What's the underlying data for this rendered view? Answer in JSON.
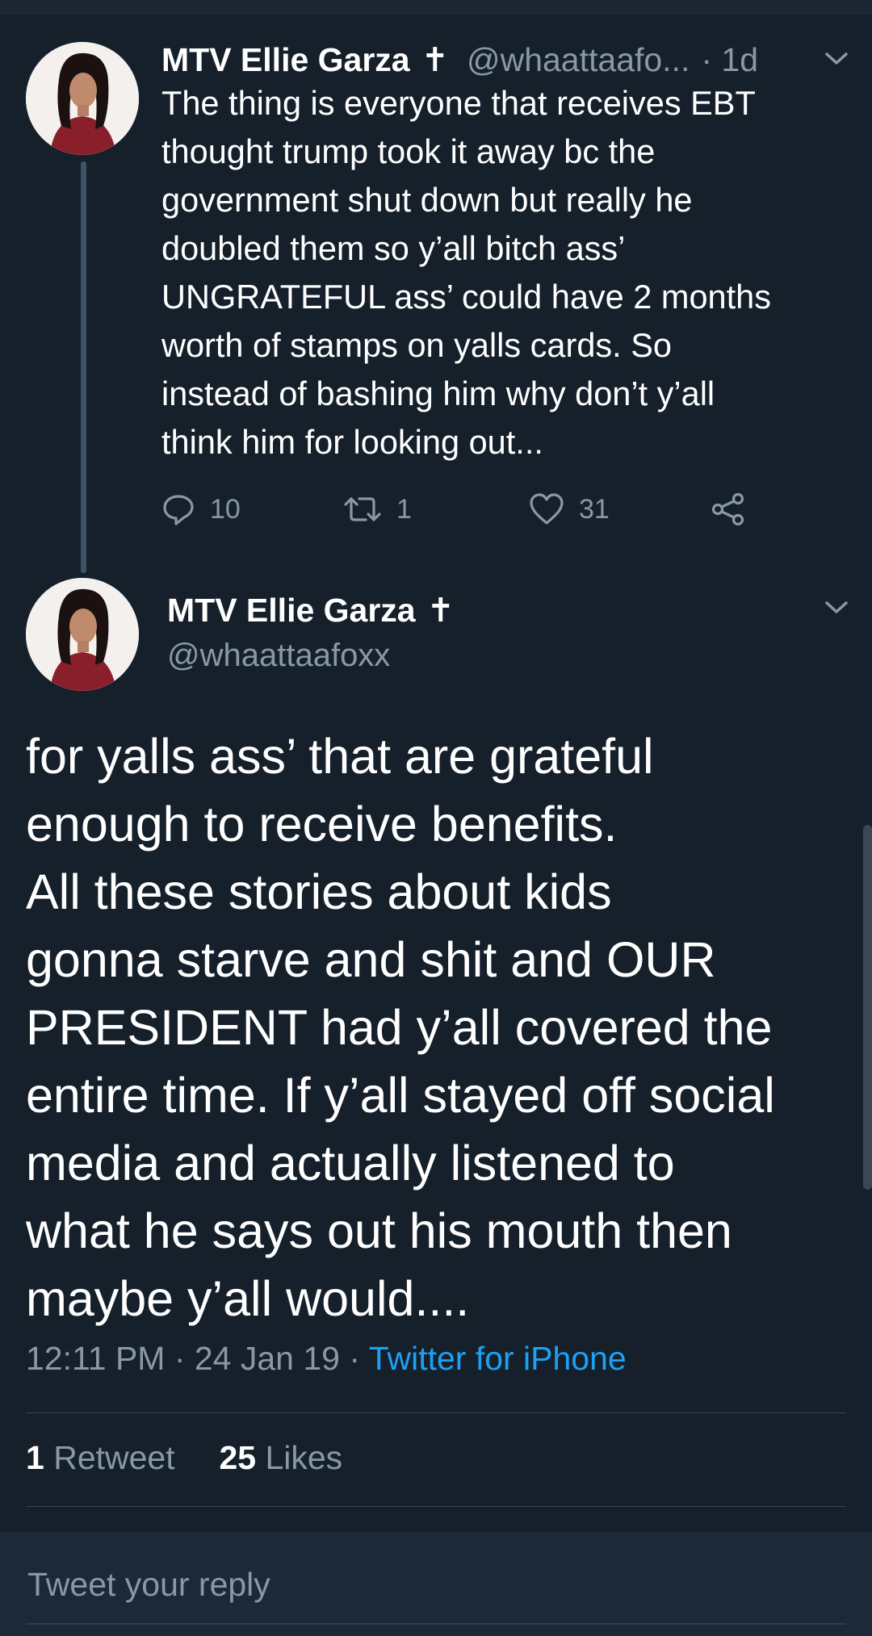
{
  "parent_tweet": {
    "display_name": "MTV Ellie Garza",
    "badge": "✝",
    "handle_truncated": "@whaattaafo...",
    "time_ago": "· 1d",
    "text": "The thing is everyone that receives EBT\nthought trump took it away bc the\ngovernment shut down but really he\ndoubled them so y’all bitch ass’\nUNGRATEFUL ass’ could have 2 months\nworth of stamps on yalls cards. So\ninstead of bashing him why don’t y’all\nthink him for looking out...",
    "reply_count": "10",
    "retweet_count": "1",
    "like_count": "31"
  },
  "main_tweet": {
    "display_name": "MTV Ellie Garza",
    "badge": "✝",
    "handle": "@whaattaafoxx",
    "text": "for yalls ass’ that are grateful\nenough to receive benefits.\nAll these stories about kids\ngonna starve and shit and OUR\nPRESIDENT had y’all covered the\nentire time. If y’all stayed off social\nmedia and actually listened to\nwhat he says out his mouth then\nmaybe y’all would....",
    "timestamp": "12:11 PM · 24 Jan 19 · ",
    "source": "Twitter for iPhone",
    "retweets_value": "1",
    "retweets_label": " Retweet",
    "likes_value": "25",
    "likes_label": " Likes"
  },
  "reply": {
    "placeholder": "Tweet your reply"
  },
  "icons": {
    "reply": "reply-icon",
    "retweet": "retweet-icon",
    "like": "heart-icon",
    "share": "share-icon",
    "menu": "chevron-down-icon"
  },
  "colors": {
    "background": "#15202b",
    "secondary_text": "#8899a6",
    "link": "#1da1f2",
    "reply_bar": "#1c2938"
  }
}
